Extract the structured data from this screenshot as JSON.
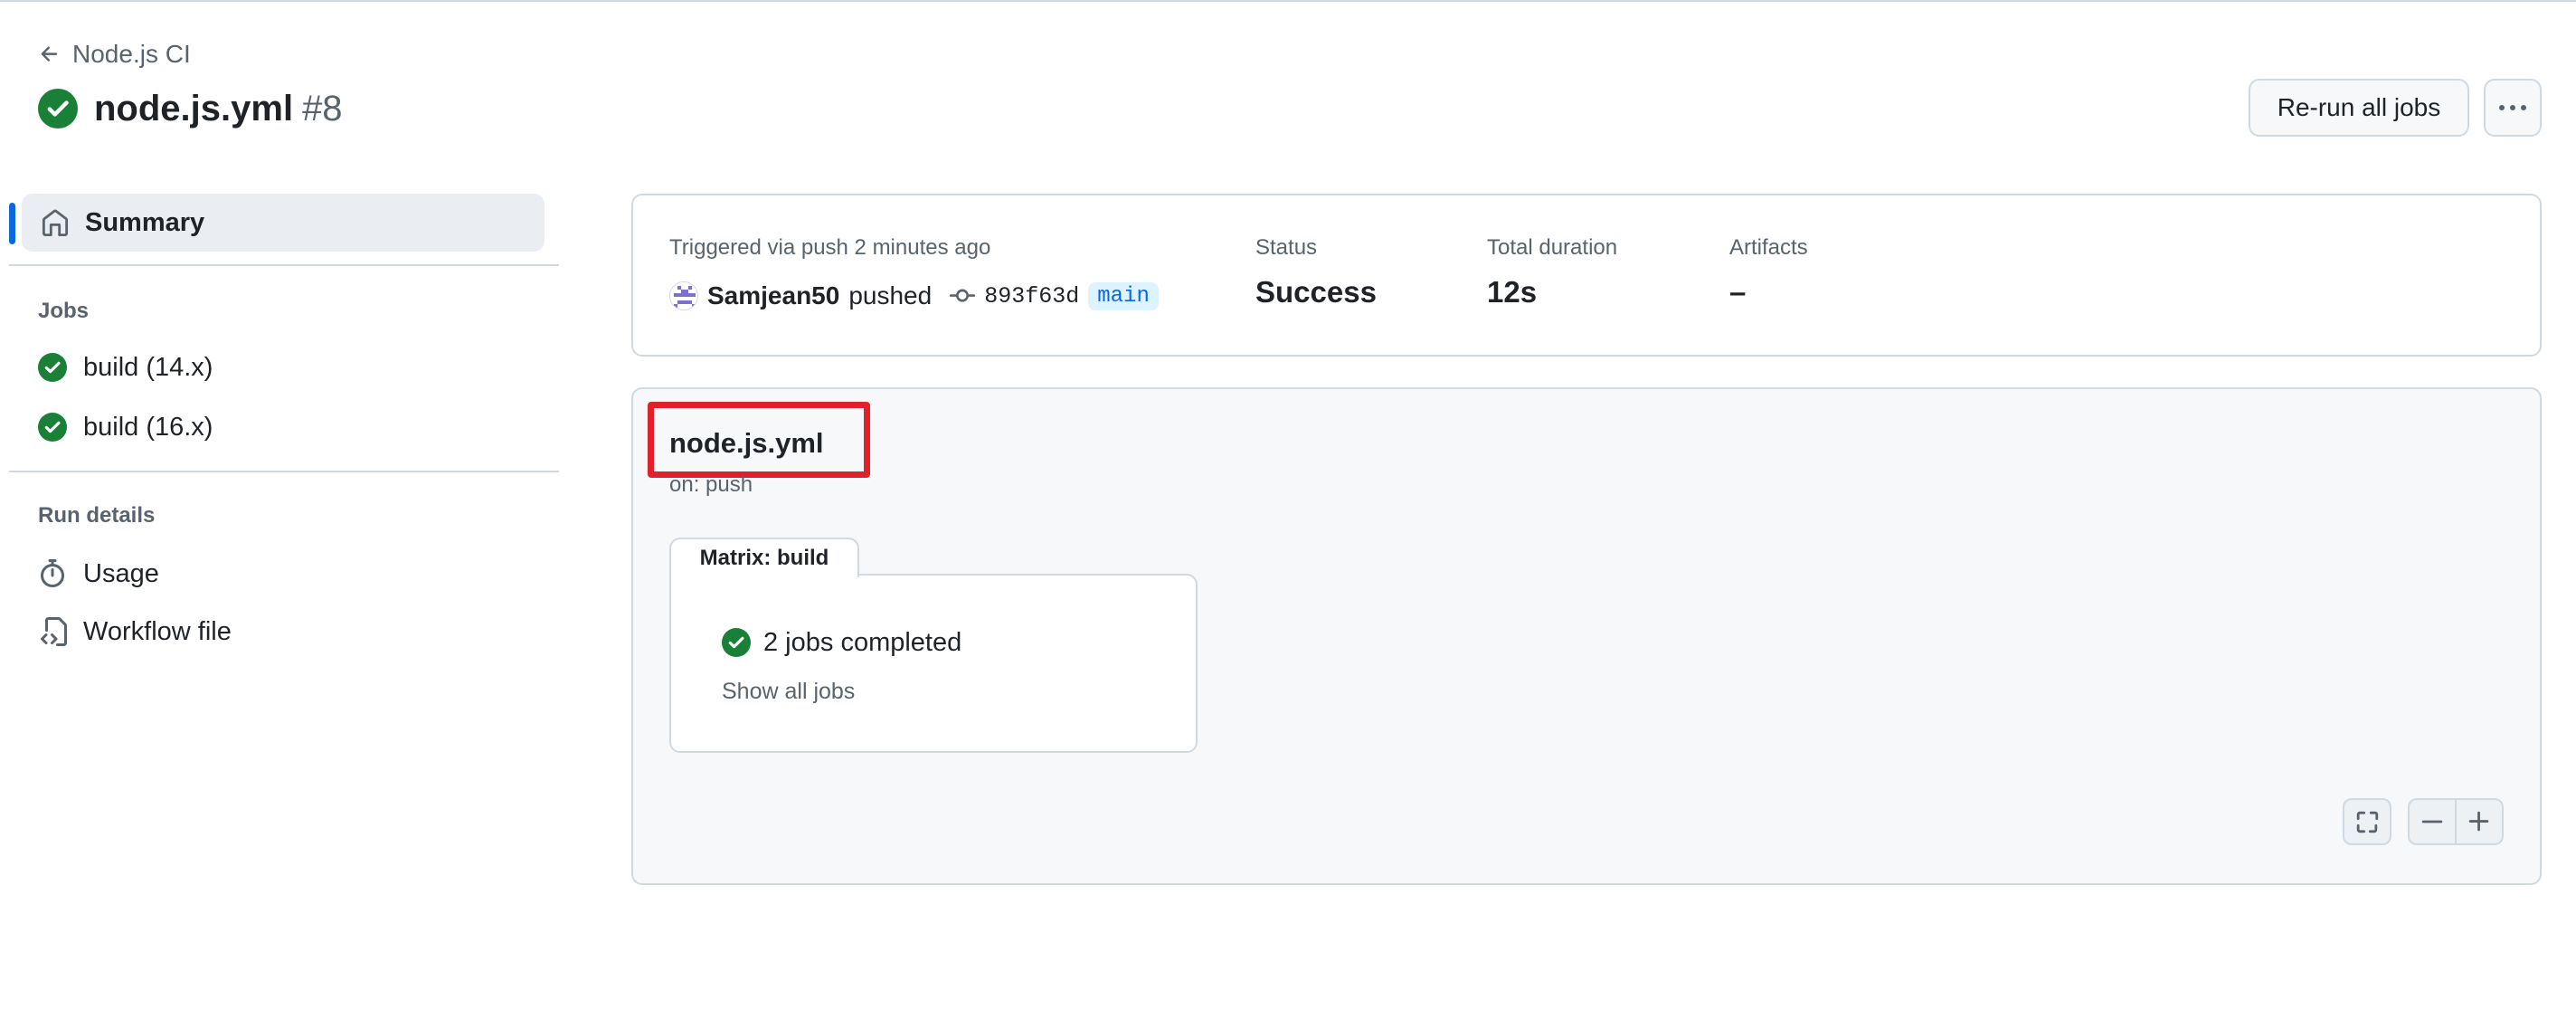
{
  "header": {
    "back_label": "Node.js CI",
    "workflow_file": "node.js.yml",
    "run_number": "#8",
    "rerun_label": "Re-run all jobs"
  },
  "sidebar": {
    "summary_label": "Summary",
    "jobs_heading": "Jobs",
    "jobs": [
      {
        "label": "build (14.x)",
        "status": "success"
      },
      {
        "label": "build (16.x)",
        "status": "success"
      }
    ],
    "run_details_heading": "Run details",
    "usage_label": "Usage",
    "workflow_file_label": "Workflow file"
  },
  "summary": {
    "trigger_text": "Triggered via push 2 minutes ago",
    "user": "Samjean50",
    "pushed_word": "pushed",
    "commit_sha": "893f63d",
    "branch": "main",
    "status_label": "Status",
    "status_value": "Success",
    "duration_label": "Total duration",
    "duration_value": "12s",
    "artifacts_label": "Artifacts",
    "artifacts_value": "–"
  },
  "graph": {
    "workflow_name": "node.js.yml",
    "trigger": "on: push",
    "matrix_label": "Matrix: build",
    "jobs_completed": "2 jobs completed",
    "show_all_label": "Show all jobs"
  },
  "colors": {
    "success_green": "#1a7f37",
    "accent_blue": "#0969da",
    "highlight_red": "#e0202a"
  },
  "icons": [
    "arrow-left-icon",
    "check-circle-icon",
    "home-icon",
    "stopwatch-icon",
    "file-code-icon",
    "git-commit-icon",
    "kebab-icon",
    "fullscreen-icon",
    "minus-icon",
    "plus-icon"
  ]
}
